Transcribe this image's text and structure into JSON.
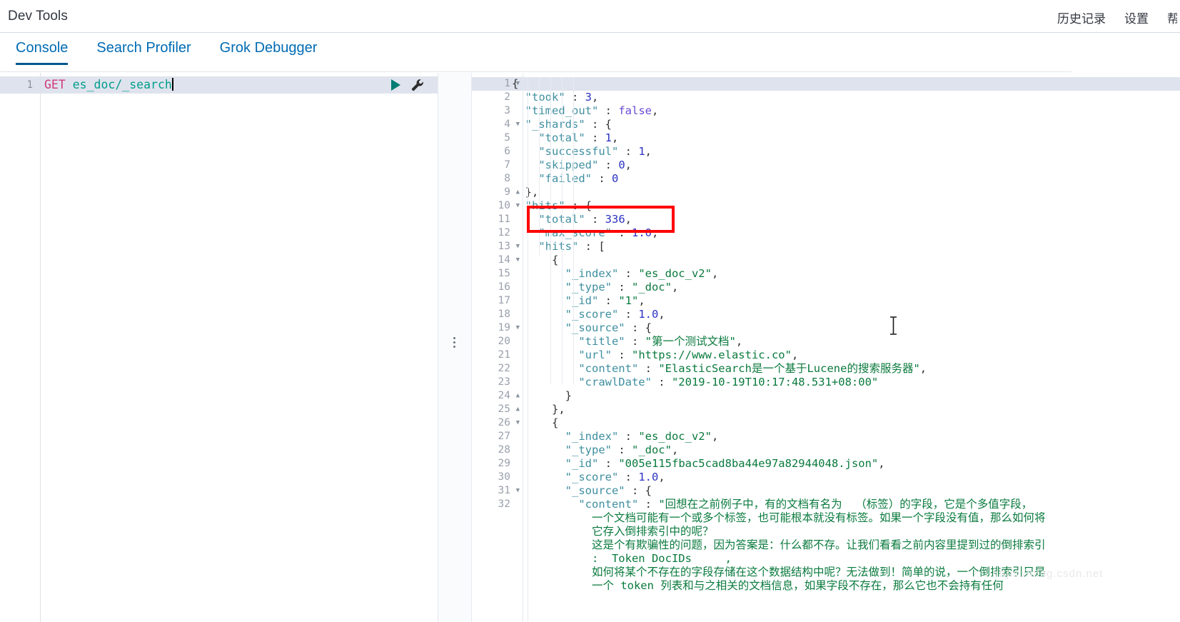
{
  "header": {
    "title": "Dev Tools",
    "nav": [
      {
        "label": "历史记录",
        "name": "history"
      },
      {
        "label": "设置",
        "name": "settings"
      },
      {
        "label": "帮助",
        "name": "help"
      }
    ]
  },
  "tabs": [
    {
      "label": "Console",
      "active": true
    },
    {
      "label": "Search Profiler",
      "active": false
    },
    {
      "label": "Grok Debugger",
      "active": false
    }
  ],
  "editor": {
    "line_number": "1",
    "method": "GET",
    "path": " es_doc/_search",
    "play_icon": "play-icon",
    "wrench_icon": "wrench-icon"
  },
  "annotation": {
    "box_color": "#ff0000",
    "highlight_lines": [
      "10",
      "11"
    ],
    "highlighted_value": "336"
  },
  "watermark": "https://blog.csdn.net",
  "response": {
    "line_numbers": [
      "1",
      "2",
      "3",
      "4",
      "5",
      "6",
      "7",
      "8",
      "9",
      "10",
      "11",
      "12",
      "13",
      "14",
      "15",
      "16",
      "17",
      "18",
      "19",
      "20",
      "21",
      "22",
      "23",
      "24",
      "25",
      "26",
      "27",
      "28",
      "29",
      "30",
      "31",
      "32"
    ],
    "folds": {
      "1": "down",
      "4": "down",
      "9": "up",
      "10": "down",
      "13": "down",
      "14": "down",
      "19": "down",
      "24": "up",
      "25": "up",
      "26": "down",
      "31": "down"
    },
    "lines": [
      [
        {
          "t": "{",
          "c": "t-brace"
        }
      ],
      [
        {
          "t": "  \"took\"",
          "c": "t-key"
        },
        {
          "t": " : ",
          "c": "t-punc"
        },
        {
          "t": "3",
          "c": "t-num"
        },
        {
          "t": ",",
          "c": "t-punc"
        }
      ],
      [
        {
          "t": "  \"timed_out\"",
          "c": "t-key"
        },
        {
          "t": " : ",
          "c": "t-punc"
        },
        {
          "t": "false",
          "c": "t-bool"
        },
        {
          "t": ",",
          "c": "t-punc"
        }
      ],
      [
        {
          "t": "  \"_shards\"",
          "c": "t-key"
        },
        {
          "t": " : ",
          "c": "t-punc"
        },
        {
          "t": "{",
          "c": "t-brace"
        }
      ],
      [
        {
          "t": "    \"total\"",
          "c": "t-key"
        },
        {
          "t": " : ",
          "c": "t-punc"
        },
        {
          "t": "1",
          "c": "t-num"
        },
        {
          "t": ",",
          "c": "t-punc"
        }
      ],
      [
        {
          "t": "    \"successful\"",
          "c": "t-key"
        },
        {
          "t": " : ",
          "c": "t-punc"
        },
        {
          "t": "1",
          "c": "t-num"
        },
        {
          "t": ",",
          "c": "t-punc"
        }
      ],
      [
        {
          "t": "    \"skipped\"",
          "c": "t-key"
        },
        {
          "t": " : ",
          "c": "t-punc"
        },
        {
          "t": "0",
          "c": "t-num"
        },
        {
          "t": ",",
          "c": "t-punc"
        }
      ],
      [
        {
          "t": "    \"failed\"",
          "c": "t-key"
        },
        {
          "t": " : ",
          "c": "t-punc"
        },
        {
          "t": "0",
          "c": "t-num"
        }
      ],
      [
        {
          "t": "  },",
          "c": "t-brace"
        }
      ],
      [
        {
          "t": "  \"hits\"",
          "c": "t-key"
        },
        {
          "t": " : ",
          "c": "t-punc"
        },
        {
          "t": "{",
          "c": "t-brace"
        }
      ],
      [
        {
          "t": "    \"total\"",
          "c": "t-key"
        },
        {
          "t": " : ",
          "c": "t-punc"
        },
        {
          "t": "336",
          "c": "t-num"
        },
        {
          "t": ",",
          "c": "t-punc"
        }
      ],
      [
        {
          "t": "    \"max_score\"",
          "c": "t-key"
        },
        {
          "t": " : ",
          "c": "t-punc"
        },
        {
          "t": "1.0",
          "c": "t-num"
        },
        {
          "t": ",",
          "c": "t-punc"
        }
      ],
      [
        {
          "t": "    \"hits\"",
          "c": "t-key"
        },
        {
          "t": " : ",
          "c": "t-punc"
        },
        {
          "t": "[",
          "c": "t-brace"
        }
      ],
      [
        {
          "t": "      {",
          "c": "t-brace"
        }
      ],
      [
        {
          "t": "        \"_index\"",
          "c": "t-key"
        },
        {
          "t": " : ",
          "c": "t-punc"
        },
        {
          "t": "\"es_doc_v2\"",
          "c": "t-str"
        },
        {
          "t": ",",
          "c": "t-punc"
        }
      ],
      [
        {
          "t": "        \"_type\"",
          "c": "t-key"
        },
        {
          "t": " : ",
          "c": "t-punc"
        },
        {
          "t": "\"_doc\"",
          "c": "t-str"
        },
        {
          "t": ",",
          "c": "t-punc"
        }
      ],
      [
        {
          "t": "        \"_id\"",
          "c": "t-key"
        },
        {
          "t": " : ",
          "c": "t-punc"
        },
        {
          "t": "\"1\"",
          "c": "t-str"
        },
        {
          "t": ",",
          "c": "t-punc"
        }
      ],
      [
        {
          "t": "        \"_score\"",
          "c": "t-key"
        },
        {
          "t": " : ",
          "c": "t-punc"
        },
        {
          "t": "1.0",
          "c": "t-num"
        },
        {
          "t": ",",
          "c": "t-punc"
        }
      ],
      [
        {
          "t": "        \"_source\"",
          "c": "t-key"
        },
        {
          "t": " : ",
          "c": "t-punc"
        },
        {
          "t": "{",
          "c": "t-brace"
        }
      ],
      [
        {
          "t": "          \"title\"",
          "c": "t-key"
        },
        {
          "t": " : ",
          "c": "t-punc"
        },
        {
          "t": "\"第一个测试文档\"",
          "c": "t-str"
        },
        {
          "t": ",",
          "c": "t-punc"
        }
      ],
      [
        {
          "t": "          \"url\"",
          "c": "t-key"
        },
        {
          "t": " : ",
          "c": "t-punc"
        },
        {
          "t": "\"https://www.elastic.co\"",
          "c": "t-str"
        },
        {
          "t": ",",
          "c": "t-punc"
        }
      ],
      [
        {
          "t": "          \"content\"",
          "c": "t-key"
        },
        {
          "t": " : ",
          "c": "t-punc"
        },
        {
          "t": "\"ElasticSearch是一个基于Lucene的搜索服务器\"",
          "c": "t-str"
        },
        {
          "t": ",",
          "c": "t-punc"
        }
      ],
      [
        {
          "t": "          \"crawlDate\"",
          "c": "t-key"
        },
        {
          "t": " : ",
          "c": "t-punc"
        },
        {
          "t": "\"2019-10-19T10:17:48.531+08:00\"",
          "c": "t-str"
        }
      ],
      [
        {
          "t": "        }",
          "c": "t-brace"
        }
      ],
      [
        {
          "t": "      },",
          "c": "t-brace"
        }
      ],
      [
        {
          "t": "      {",
          "c": "t-brace"
        }
      ],
      [
        {
          "t": "        \"_index\"",
          "c": "t-key"
        },
        {
          "t": " : ",
          "c": "t-punc"
        },
        {
          "t": "\"es_doc_v2\"",
          "c": "t-str"
        },
        {
          "t": ",",
          "c": "t-punc"
        }
      ],
      [
        {
          "t": "        \"_type\"",
          "c": "t-key"
        },
        {
          "t": " : ",
          "c": "t-punc"
        },
        {
          "t": "\"_doc\"",
          "c": "t-str"
        },
        {
          "t": ",",
          "c": "t-punc"
        }
      ],
      [
        {
          "t": "        \"_id\"",
          "c": "t-key"
        },
        {
          "t": " : ",
          "c": "t-punc"
        },
        {
          "t": "\"005e115fbac5cad8ba44e97a82944048.json\"",
          "c": "t-str"
        },
        {
          "t": ",",
          "c": "t-punc"
        }
      ],
      [
        {
          "t": "        \"_score\"",
          "c": "t-key"
        },
        {
          "t": " : ",
          "c": "t-punc"
        },
        {
          "t": "1.0",
          "c": "t-num"
        },
        {
          "t": ",",
          "c": "t-punc"
        }
      ],
      [
        {
          "t": "        \"_source\"",
          "c": "t-key"
        },
        {
          "t": " : ",
          "c": "t-punc"
        },
        {
          "t": "{",
          "c": "t-brace"
        }
      ],
      [
        {
          "t": "          \"content\"",
          "c": "t-key"
        },
        {
          "t": " : ",
          "c": "t-punc"
        },
        {
          "t": "\"回想在之前例子中，有的文档有名为  （标签）的字段，它是个多值字段，",
          "c": "t-str"
        }
      ]
    ],
    "wrapped_lines": [
      "一个文档可能有一个或多个标签，也可能根本就没有标签。如果一个字段没有值，那么如何将",
      "它存入倒排索引中的呢？",
      "这是个有欺骗性的问题，因为答案是：什么都不存。让我们看看之前内容里提到过的倒排索引",
      ":  Token DocIDs     ,",
      "如何将某个不存在的字段存储在这个数据结构中呢？无法做到！简单的说，一个倒排索引只是",
      "一个 token 列表和与之相关的文档信息，如果字段不存在，那么它也不会持有任何"
    ]
  }
}
